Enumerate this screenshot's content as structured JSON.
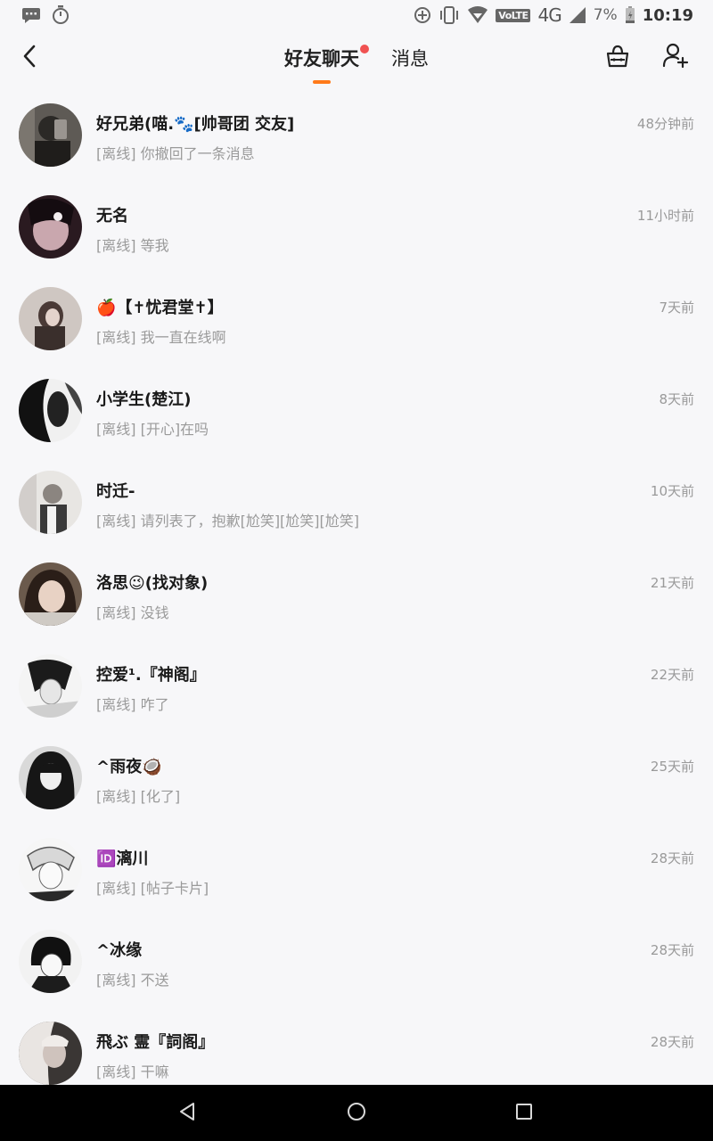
{
  "status_bar": {
    "left_icons": [
      "message-icon",
      "timer-icon"
    ],
    "right_icons": [
      "data-saver-icon",
      "vibrate-icon",
      "wifi-icon",
      "volte-icon",
      "signal-icon",
      "battery-icon"
    ],
    "volte": "VoLTE",
    "network": "4G",
    "battery": "7%",
    "time": "10:19"
  },
  "header": {
    "tabs": [
      {
        "label": "好友聊天",
        "active": true,
        "has_dot": true
      },
      {
        "label": "消息",
        "active": false
      }
    ],
    "accent_color": "#ff7a1a",
    "dot_color": "#f05252"
  },
  "conversations": [
    {
      "name": "好兄弟(喵.🐾[帅哥团 交友]",
      "preview": "[离线] 你撤回了一条消息",
      "time": "48分钟前"
    },
    {
      "name": "无名",
      "preview": "[离线] 等我",
      "time": "11小时前"
    },
    {
      "name": "🍎【✝忧君堂✝】",
      "preview": "[离线] 我一直在线啊",
      "time": "7天前"
    },
    {
      "name": "小学生(楚江)",
      "preview": "[离线] [开心]在吗",
      "time": "8天前"
    },
    {
      "name": "时迁-",
      "preview": "[离线] 请列表了，抱歉[尬笑][尬笑][尬笑]",
      "time": "10天前"
    },
    {
      "name": "洛思😉(找对象)",
      "preview": "[离线] 没钱",
      "time": "21天前"
    },
    {
      "name": "控爱¹.『神阁』",
      "preview": "[离线] 咋了",
      "time": "22天前"
    },
    {
      "name": "^雨夜🥥",
      "preview": "[离线] [化了]",
      "time": "25天前"
    },
    {
      "name": "🆔漓川",
      "preview": "[离线] [帖子卡片]",
      "time": "28天前"
    },
    {
      "name": "^冰缘",
      "preview": "[离线] 不送",
      "time": "28天前"
    },
    {
      "name": "飛ぶ 霊『詞阁』",
      "preview": "[离线] 干嘛",
      "time": "28天前"
    }
  ],
  "nav_bar": {
    "buttons": [
      "back-triangle-icon",
      "home-circle-icon",
      "recents-square-icon"
    ]
  }
}
